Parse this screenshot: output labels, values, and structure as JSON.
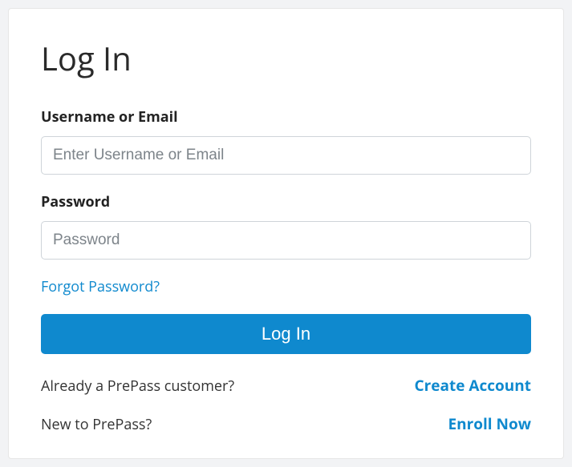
{
  "header": {
    "title": "Log In"
  },
  "form": {
    "username": {
      "label": "Username or Email",
      "placeholder": "Enter Username or Email",
      "value": ""
    },
    "password": {
      "label": "Password",
      "placeholder": "Password",
      "value": ""
    },
    "forgot_label": "Forgot Password?",
    "submit_label": "Log In"
  },
  "footer": {
    "existing": {
      "question": "Already a PrePass customer?",
      "action": "Create Account"
    },
    "new": {
      "question": "New to PrePass?",
      "action": "Enroll Now"
    }
  }
}
